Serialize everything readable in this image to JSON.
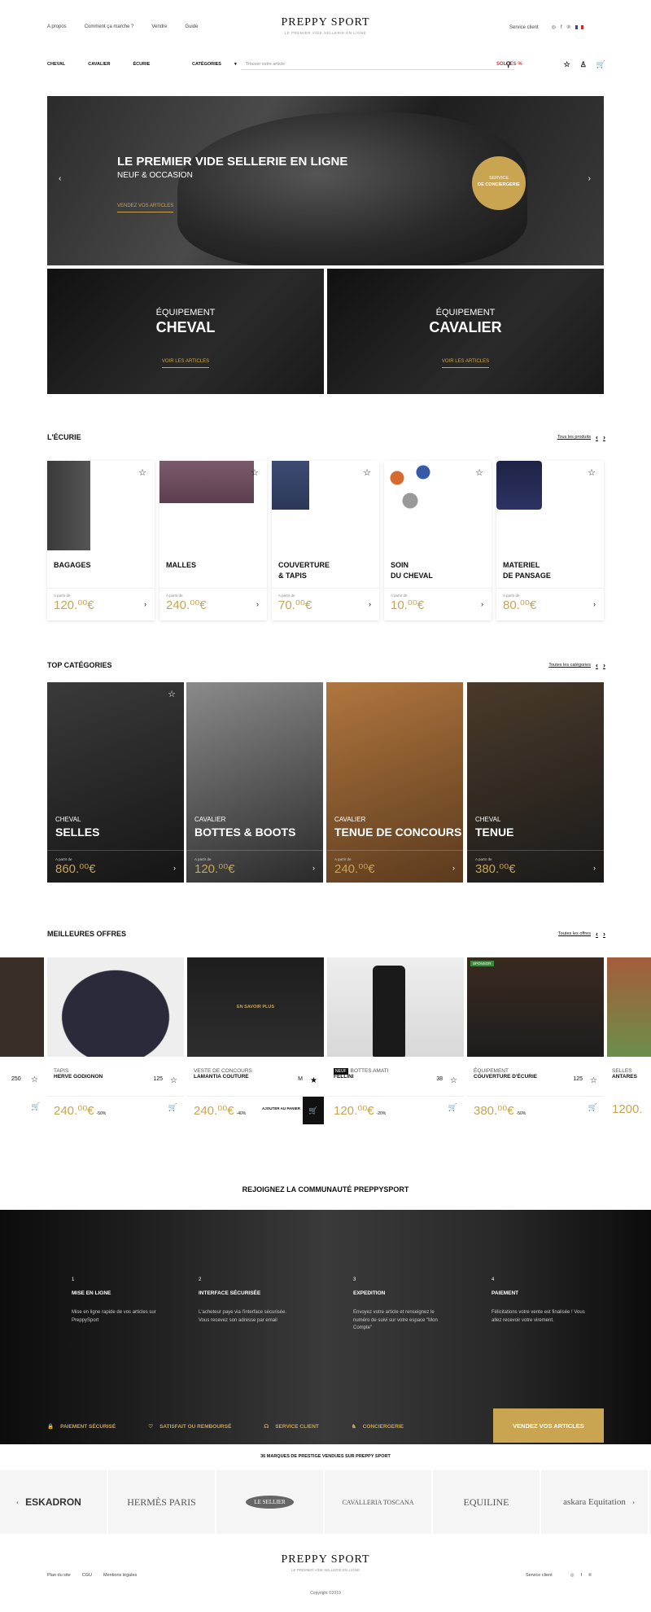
{
  "topnav": [
    "A propos",
    "Comment ça marche ?",
    "Vendre",
    "Guide"
  ],
  "brand": {
    "name": "PREPPY SPORT",
    "tagline": "LE PREMIER VIDE SELLERIE EN LIGNE"
  },
  "topright": {
    "service": "Service client",
    "social_icons": [
      "instagram-icon",
      "facebook-icon",
      "pinterest-icon"
    ]
  },
  "mainnav": {
    "items": [
      "CHEVAL",
      "CAVALIER",
      "ÉCURIE"
    ],
    "category_label": "CATÉGORIES",
    "search_placeholder": "Trouver votre article",
    "sale": "SOLDES %"
  },
  "hero": {
    "title": "LE PREMIER VIDE SELLERIE EN LIGNE",
    "subtitle": "NEUF & OCCASION",
    "cta": "VENDEZ VOS ARTICLES",
    "badge_line1": "SERVICE",
    "badge_line2": "DE CONCIERGERIE"
  },
  "split": [
    {
      "label": "ÉQUIPEMENT",
      "title": "CHEVAL",
      "cta": "VOIR LES ARTICLES"
    },
    {
      "label": "ÉQUIPEMENT",
      "title": "CAVALIER",
      "cta": "VOIR LES ARTICLES"
    }
  ],
  "ecurie": {
    "title": "L'ÉCURIE",
    "link": "Tous les produits",
    "items": [
      {
        "name": "BAGAGES",
        "from": "A partir de",
        "price": "120.⁰⁰€"
      },
      {
        "name": "MALLES",
        "from": "A partir de",
        "price": "240.⁰⁰€"
      },
      {
        "name": "COUVERTURE\n& TAPIS",
        "from": "A partir de",
        "price": "70.⁰⁰€"
      },
      {
        "name": "SOIN\nDU CHEVAL",
        "from": "A partir de",
        "price": "10.⁰⁰€"
      },
      {
        "name": "MATERIEL\nDE PANSAGE",
        "from": "A partir de",
        "price": "80.⁰⁰€"
      }
    ]
  },
  "topcat": {
    "title": "TOP CATÉGORIES",
    "link": "Toutes les catégories",
    "items": [
      {
        "sub": "CHEVAL",
        "name": "SELLES",
        "from": "A partir de",
        "price": "860.⁰⁰€"
      },
      {
        "sub": "CAVALIER",
        "name": "BOTTES & BOOTS",
        "from": "A partir de",
        "price": "120.⁰⁰€"
      },
      {
        "sub": "CAVALIER",
        "name": "TENUE DE CONCOURS",
        "from": "A partir de",
        "price": "240.⁰⁰€"
      },
      {
        "sub": "CHEVAL",
        "name": "TENUE",
        "from": "A partir de",
        "price": "380.⁰⁰€"
      }
    ]
  },
  "offres": {
    "title": "MEILLEURES OFFRES",
    "link": "Toutes les offres",
    "items": [
      {
        "c1": "TAPIS",
        "c2": "HERVE GODIGNON",
        "size": "125",
        "price": "240.⁰⁰€",
        "disc": "-50%"
      },
      {
        "c1": "VESTE DE CONCOURS",
        "c2": "LAMANTIA COUTURE",
        "size": "M",
        "price": "240.⁰⁰€",
        "disc": "-40%",
        "hover": "EN SAVOIR PLUS",
        "addcart": "AJOUTER AU PANIER"
      },
      {
        "c1": "BOTTES AMATI",
        "c2": "FELLINI",
        "size": "38",
        "price": "120.⁰⁰€",
        "disc": "-20%",
        "badge": "NEUF"
      },
      {
        "c1": "ÉQUIPEMENT",
        "c2": "COUVERTURE D'ÉCURIE",
        "size": "125",
        "price": "380.⁰⁰€",
        "disc": "-50%",
        "badge": "SPONSOR"
      }
    ],
    "edge_left_size": "250",
    "edge_right": {
      "c1": "SELLES",
      "c2": "ANTARES",
      "price": "1200."
    }
  },
  "community": {
    "title": "REJOIGNEZ LA COMMUNAUTÉ PREPPYSPORT",
    "steps": [
      {
        "n": "1",
        "t": "MISE EN LIGNE",
        "d": "Mise en ligne rapide de vos articles sur PreppySport"
      },
      {
        "n": "2",
        "t": "INTERFACE SÉCURISÉE",
        "d": "L'acheteur paye via l'interface sécurisée. Vous recevez son adresse par email"
      },
      {
        "n": "3",
        "t": "EXPEDITION",
        "d": "Envoyez votre article et renseignez le numéro de suivi sur votre espace \"Mon Compte\""
      },
      {
        "n": "4",
        "t": "PAIEMENT",
        "d": "Félicitations votre vente est finalisée ! Vous allez recevoir votre virement."
      }
    ],
    "perks": [
      "PAIEMENT SÉCURISÉ",
      "SATISFAIT OU REMBOURSÉ",
      "SERVICE CLIENT",
      "CONCIERGERIE"
    ],
    "sell": "VENDEZ VOS ARTICLES"
  },
  "brands": {
    "title": "36 MARQUES DE PRESTIGE VENDUES SUR PREPPY SPORT",
    "items": [
      "ESKADRON",
      "HERMÈS PARIS",
      "LE SELLIER",
      "CAVALLERIA TOSCANA",
      "EQUILINE",
      "askara Equitation"
    ]
  },
  "footer": {
    "links": [
      "Plan du site",
      "CGU",
      "Mentions légales"
    ],
    "service": "Service client",
    "copyright": "Copyright ©2019"
  },
  "colors": {
    "gold": "#c9a451",
    "sale": "#dd3333",
    "dark": "#1a1a1a"
  }
}
